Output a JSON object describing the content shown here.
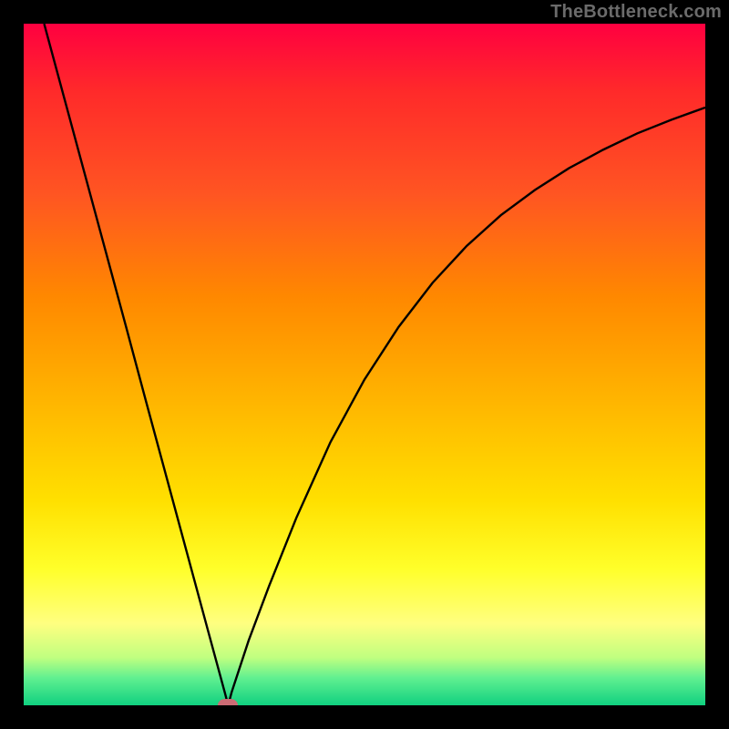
{
  "watermark": "TheBottleneck.com",
  "chart_data": {
    "type": "line",
    "title": "",
    "xlabel": "",
    "ylabel": "",
    "xlim": [
      0,
      1
    ],
    "ylim": [
      0,
      1
    ],
    "grid": false,
    "legend": false,
    "minimum_marker": {
      "x": 0.3,
      "y": 0.0
    },
    "series": [
      {
        "name": "curve",
        "x": [
          0.03,
          0.06,
          0.09,
          0.12,
          0.15,
          0.18,
          0.21,
          0.24,
          0.27,
          0.295,
          0.3,
          0.305,
          0.33,
          0.36,
          0.4,
          0.45,
          0.5,
          0.55,
          0.6,
          0.65,
          0.7,
          0.75,
          0.8,
          0.85,
          0.9,
          0.95,
          1.0
        ],
        "y": [
          1.0,
          0.889,
          0.778,
          0.667,
          0.556,
          0.444,
          0.333,
          0.222,
          0.111,
          0.019,
          0.0,
          0.019,
          0.095,
          0.175,
          0.275,
          0.386,
          0.478,
          0.555,
          0.62,
          0.674,
          0.719,
          0.756,
          0.788,
          0.815,
          0.839,
          0.859,
          0.877
        ]
      }
    ]
  },
  "colors": {
    "curve": "#000000",
    "marker": "#cc6b74",
    "frame": "#000000"
  }
}
